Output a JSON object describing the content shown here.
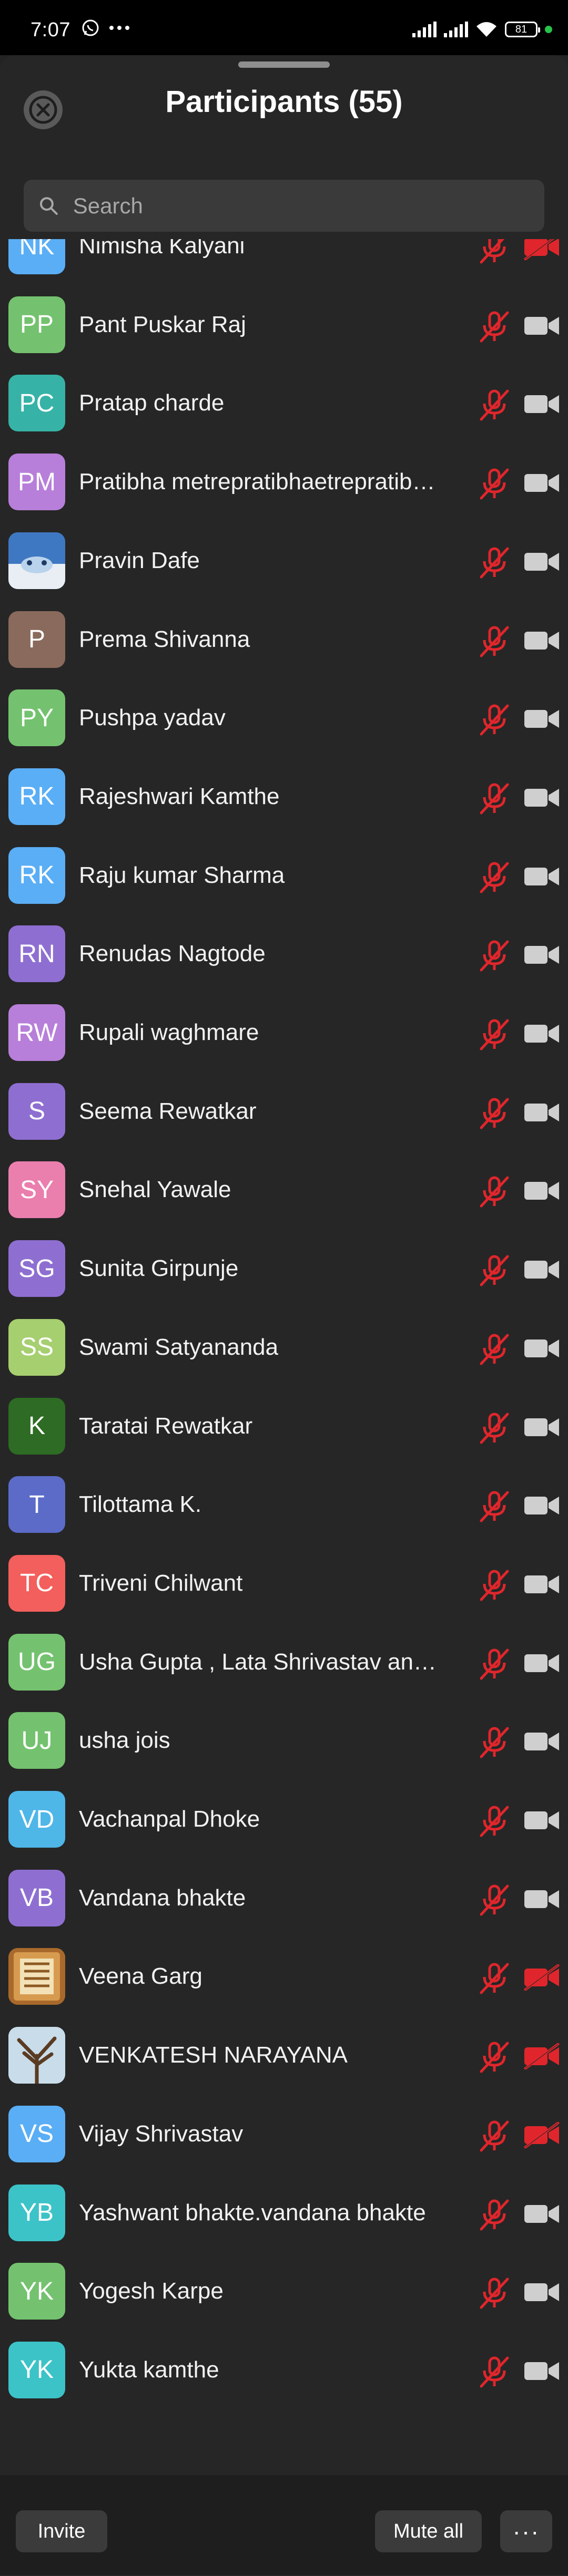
{
  "status_bar": {
    "time": "7:07",
    "battery": "81",
    "icons": [
      "whatsapp-icon",
      "more-dots-icon",
      "signal-icon",
      "signal-icon",
      "wifi-icon",
      "battery-icon"
    ]
  },
  "header": {
    "title": "Participants (55)",
    "close_icon": "close-icon"
  },
  "search": {
    "placeholder": "Search"
  },
  "colors": {
    "mic_muted": "#e0262c",
    "cam_off": "#e0262c",
    "cam_gray": "#cfcfcf"
  },
  "participants": [
    {
      "initials": "NK",
      "name": "Nimisha Kalyani",
      "color": "#5aaef5",
      "avatar_type": "initials",
      "cam_off": true
    },
    {
      "initials": "PP",
      "name": "Pant Puskar Raj",
      "color": "#74c26f",
      "avatar_type": "initials",
      "cam_off": false
    },
    {
      "initials": "PC",
      "name": "Pratap charde",
      "color": "#36b3a6",
      "avatar_type": "initials",
      "cam_off": false
    },
    {
      "initials": "PM",
      "name": "Pratibha metrepratibhaetrepratib…",
      "color": "#b77fd9",
      "avatar_type": "initials",
      "cam_off": false
    },
    {
      "initials": "",
      "name": "Pravin Dafe",
      "color": "#4b7fc4",
      "avatar_type": "photo-sky",
      "cam_off": false
    },
    {
      "initials": "P",
      "name": "Prema Shivanna",
      "color": "#8a6a5c",
      "avatar_type": "initials",
      "cam_off": false
    },
    {
      "initials": "PY",
      "name": "Pushpa yadav",
      "color": "#74c26f",
      "avatar_type": "initials",
      "cam_off": false
    },
    {
      "initials": "RK",
      "name": "Rajeshwari Kamthe",
      "color": "#5aaef5",
      "avatar_type": "initials",
      "cam_off": false
    },
    {
      "initials": "RK",
      "name": "Raju kumar Sharma",
      "color": "#5aaef5",
      "avatar_type": "initials",
      "cam_off": false
    },
    {
      "initials": "RN",
      "name": "Renudas Nagtode",
      "color": "#8e6fd1",
      "avatar_type": "initials",
      "cam_off": false
    },
    {
      "initials": "RW",
      "name": "Rupali waghmare",
      "color": "#b77fd9",
      "avatar_type": "initials",
      "cam_off": false
    },
    {
      "initials": "S",
      "name": "Seema  Rewatkar",
      "color": "#8e6fd1",
      "avatar_type": "initials",
      "cam_off": false
    },
    {
      "initials": "SY",
      "name": "Snehal Yawale",
      "color": "#ea7fae",
      "avatar_type": "initials",
      "cam_off": false
    },
    {
      "initials": "SG",
      "name": "Sunita Girpunje",
      "color": "#8e6fd1",
      "avatar_type": "initials",
      "cam_off": false
    },
    {
      "initials": "SS",
      "name": "Swami Satyananda",
      "color": "#a6cf6f",
      "avatar_type": "initials",
      "cam_off": false
    },
    {
      "initials": "K",
      "name": "Taratai Rewatkar",
      "color": "#2e6b24",
      "avatar_type": "initials",
      "cam_off": false
    },
    {
      "initials": "T",
      "name": "Tilottama K.",
      "color": "#5c6bc8",
      "avatar_type": "initials",
      "cam_off": false
    },
    {
      "initials": "TC",
      "name": "Triveni Chilwant",
      "color": "#f25f5c",
      "avatar_type": "initials",
      "cam_off": false
    },
    {
      "initials": "UG",
      "name": "Usha Gupta , Lata Shrivastav and…",
      "color": "#74c26f",
      "avatar_type": "initials",
      "cam_off": false
    },
    {
      "initials": "UJ",
      "name": "usha jois",
      "color": "#74c26f",
      "avatar_type": "initials",
      "cam_off": false
    },
    {
      "initials": "VD",
      "name": "Vachanpal Dhoke",
      "color": "#4fb6e8",
      "avatar_type": "initials",
      "cam_off": false
    },
    {
      "initials": "VB",
      "name": "Vandana bhakte",
      "color": "#8e6fd1",
      "avatar_type": "initials",
      "cam_off": false
    },
    {
      "initials": "",
      "name": "Veena Garg",
      "color": "#b87a35",
      "avatar_type": "photo-wood",
      "cam_off": true
    },
    {
      "initials": "",
      "name": "VENKATESH NARAYANA",
      "color": "#9bbdd8",
      "avatar_type": "photo-tree",
      "cam_off": true
    },
    {
      "initials": "VS",
      "name": "Vijay Shrivastav",
      "color": "#5aaef5",
      "avatar_type": "initials",
      "cam_off": true
    },
    {
      "initials": "YB",
      "name": "Yashwant bhakte.vandana bhakte",
      "color": "#3cc3c8",
      "avatar_type": "initials",
      "cam_off": false
    },
    {
      "initials": "YK",
      "name": "Yogesh Karpe",
      "color": "#74c26f",
      "avatar_type": "initials",
      "cam_off": false
    },
    {
      "initials": "YK",
      "name": "Yukta kamthe",
      "color": "#3cc3c8",
      "avatar_type": "initials",
      "cam_off": false
    }
  ],
  "footer": {
    "invite_label": "Invite",
    "mute_all_label": "Mute all",
    "more_label": "···"
  }
}
